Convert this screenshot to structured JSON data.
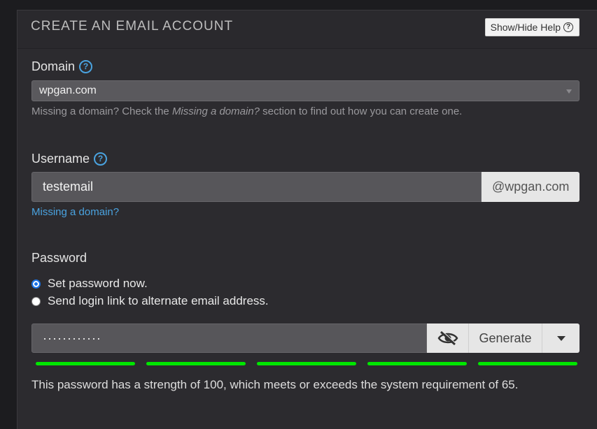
{
  "panel": {
    "title": "CREATE AN EMAIL ACCOUNT",
    "help_toggle_label": "Show/Hide Help",
    "help_toggle_icon": "question-circle-icon"
  },
  "domain": {
    "label": "Domain",
    "selected": "wpgan.com",
    "help_prefix": "Missing a domain? Check the ",
    "help_em": "Missing a domain?",
    "help_suffix": " section to find out how you can create one."
  },
  "username": {
    "label": "Username",
    "value": "testemail",
    "suffix": "@wpgan.com",
    "link": "Missing a domain?"
  },
  "password": {
    "label": "Password",
    "options": [
      {
        "label": "Set password now.",
        "checked": true
      },
      {
        "label": "Send login link to alternate email address.",
        "checked": false
      }
    ],
    "masked_value": "············",
    "toggle_icon": "eye-slash-icon",
    "generate_label": "Generate",
    "strength_segments_filled": 5,
    "strength_segments_total": 5,
    "strength_color": "#00e600",
    "strength_text": "This password has a strength of 100, which meets or exceeds the system requirement of 65."
  },
  "colors": {
    "accent_link": "#4aa3e0",
    "panel_bg": "#2c2b2f"
  }
}
